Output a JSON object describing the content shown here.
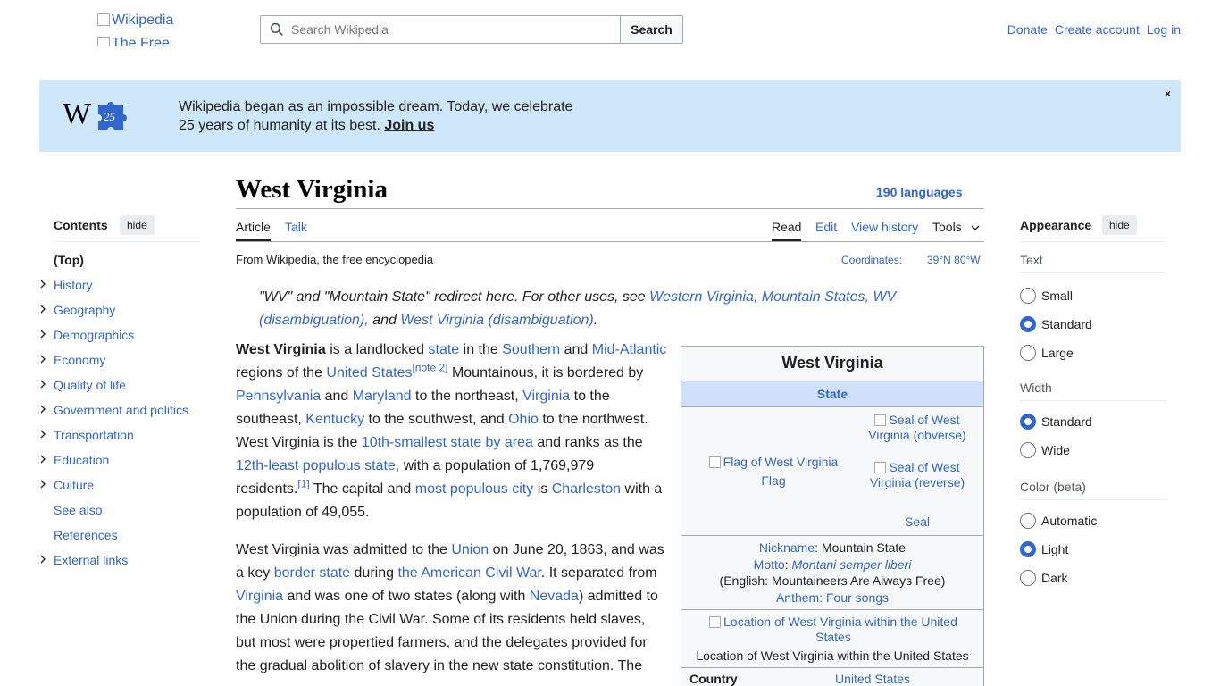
{
  "header": {
    "logo_alt": "Wikipedia",
    "logo_alt2": "The Free",
    "search_placeholder": "Search Wikipedia",
    "search_button": "Search",
    "links": [
      "Donate",
      "Create account",
      "Log in"
    ]
  },
  "banner": {
    "line1": "Wikipedia began as an impossible dream. Today, we celebrate",
    "line2": "25 years of humanity at its best.",
    "cta": "Join us",
    "close": "×",
    "logo_letter": "W",
    "logo_number": "25"
  },
  "toc": {
    "title": "Contents",
    "hide": "hide",
    "items": [
      {
        "label": "(Top)",
        "expandable": false,
        "bold": true
      },
      {
        "label": "History",
        "expandable": true
      },
      {
        "label": "Geography",
        "expandable": true
      },
      {
        "label": "Demographics",
        "expandable": true
      },
      {
        "label": "Economy",
        "expandable": true
      },
      {
        "label": "Quality of life",
        "expandable": true
      },
      {
        "label": "Government and politics",
        "expandable": true
      },
      {
        "label": "Transportation",
        "expandable": true
      },
      {
        "label": "Education",
        "expandable": true
      },
      {
        "label": "Culture",
        "expandable": true
      },
      {
        "label": "See also",
        "expandable": false
      },
      {
        "label": "References",
        "expandable": false
      },
      {
        "label": "External links",
        "expandable": true
      }
    ]
  },
  "article": {
    "title": "West Virginia",
    "languages": "190 languages",
    "tabs_left": [
      "Article",
      "Talk"
    ],
    "tabs_right": [
      "Read",
      "Edit",
      "View history",
      "Tools"
    ],
    "from": "From Wikipedia, the free encyclopedia",
    "coords_label": "Coordinates:",
    "coords_value": "39°N 80°W",
    "hatnote_pre": "\"WV\" and \"Mountain State\" redirect here. For other uses, see ",
    "hatnote_link1": "Western Virginia, Mountain States, WV (disambiguation),",
    "hatnote_mid": " and ",
    "hatnote_link2": "West Virginia (disambiguation)",
    "hatnote_end": "."
  },
  "infobox": {
    "title": "West Virginia",
    "subtitle": "State",
    "flag_alt": "Flag of West Virginia",
    "flag_caption": "Flag",
    "seal1_alt": "Seal of West Virginia (obverse)",
    "seal2_alt": "Seal of West Virginia (reverse)",
    "seal_caption": "Seal",
    "nickname_label": "Nickname",
    "nickname_value": "Mountain State",
    "motto_label": "Motto",
    "motto_value": "Montani semper liberi",
    "motto_english": "(English: Mountaineers Are Always Free)",
    "anthem_label": "Anthem",
    "anthem_value": "Four songs",
    "map_alt": "Location of West Virginia within the United States",
    "map_caption": "Location of West Virginia within the United States",
    "country_label": "Country",
    "country_value": "United States"
  },
  "appearance": {
    "title": "Appearance",
    "hide": "hide",
    "text_label": "Text",
    "text_options": [
      "Small",
      "Standard",
      "Large"
    ],
    "text_selected": "Standard",
    "width_label": "Width",
    "width_options": [
      "Standard",
      "Wide"
    ],
    "width_selected": "Standard",
    "color_label": "Color (beta)",
    "color_options": [
      "Automatic",
      "Light",
      "Dark"
    ],
    "color_selected": "Light"
  },
  "colors": {
    "link": "#3366cc",
    "banner_bg": "#cfe7fa",
    "infobox_header": "#cfe0fa"
  }
}
